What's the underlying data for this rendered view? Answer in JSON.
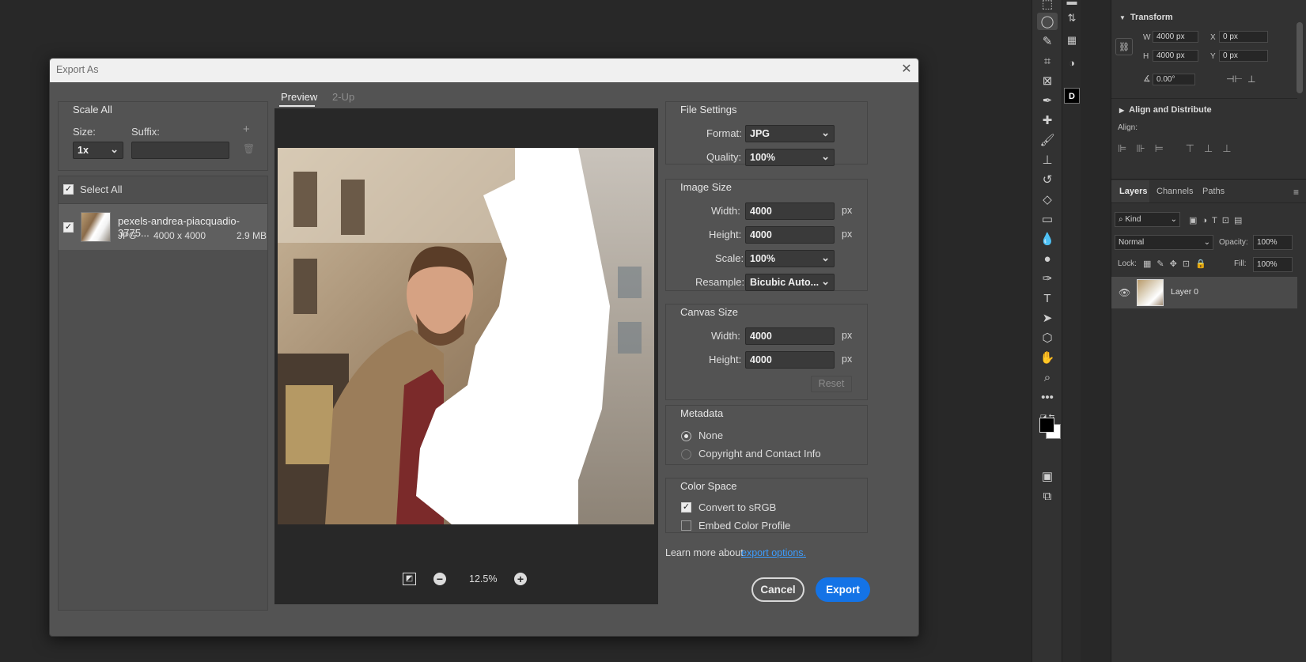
{
  "dialog": {
    "title": "Export As",
    "scale_all": {
      "heading": "Scale All",
      "size_label": "Size:",
      "suffix_label": "Suffix:",
      "size_value": "1x",
      "suffix_value": ""
    },
    "select_all": {
      "label": "Select All",
      "checked": true
    },
    "asset": {
      "name": "pexels-andrea-piacquadio-3775...",
      "format": "JPG",
      "dimensions": "4000 x 4000",
      "filesize": "2.9 MB"
    },
    "preview_tabs": [
      "Preview",
      "2-Up"
    ],
    "zoom": "12.5%",
    "file_settings": {
      "heading": "File Settings",
      "format_label": "Format:",
      "format_value": "JPG",
      "quality_label": "Quality:",
      "quality_value": "100%"
    },
    "image_size": {
      "heading": "Image Size",
      "width_label": "Width:",
      "width_value": "4000",
      "height_label": "Height:",
      "height_value": "4000",
      "unit": "px",
      "scale_label": "Scale:",
      "scale_value": "100%",
      "resample_label": "Resample:",
      "resample_value": "Bicubic Auto..."
    },
    "canvas_size": {
      "heading": "Canvas Size",
      "width_label": "Width:",
      "width_value": "4000",
      "height_label": "Height:",
      "height_value": "4000",
      "unit": "px",
      "reset_label": "Reset"
    },
    "metadata": {
      "heading": "Metadata",
      "options": [
        "None",
        "Copyright and Contact Info"
      ],
      "selected": "None"
    },
    "color_space": {
      "heading": "Color Space",
      "convert_label": "Convert to sRGB",
      "convert_checked": true,
      "embed_label": "Embed Color Profile",
      "embed_checked": false
    },
    "learn_more": {
      "text": "Learn more about",
      "link": "export options."
    },
    "cancel_label": "Cancel",
    "export_label": "Export"
  },
  "properties": {
    "transform": {
      "heading": "Transform",
      "w_label": "W",
      "w_value": "4000 px",
      "h_label": "H",
      "h_value": "4000 px",
      "x_label": "X",
      "x_value": "0 px",
      "y_label": "Y",
      "y_value": "0 px",
      "angle_value": "0.00°"
    },
    "align": {
      "heading": "Align and Distribute",
      "align_label": "Align:"
    }
  },
  "layers": {
    "tabs": [
      "Layers",
      "Channels",
      "Paths"
    ],
    "filter_kind": "Kind",
    "blend_mode": "Normal",
    "opacity_label": "Opacity:",
    "opacity_value": "100%",
    "lock_label": "Lock:",
    "fill_label": "Fill:",
    "fill_value": "100%",
    "items": [
      {
        "name": "Layer 0",
        "visible": true
      }
    ]
  },
  "colors": {
    "accent": "#1473e6",
    "link": "#3b9cff",
    "dialog_bg": "#535353",
    "app_bg": "#282828"
  }
}
